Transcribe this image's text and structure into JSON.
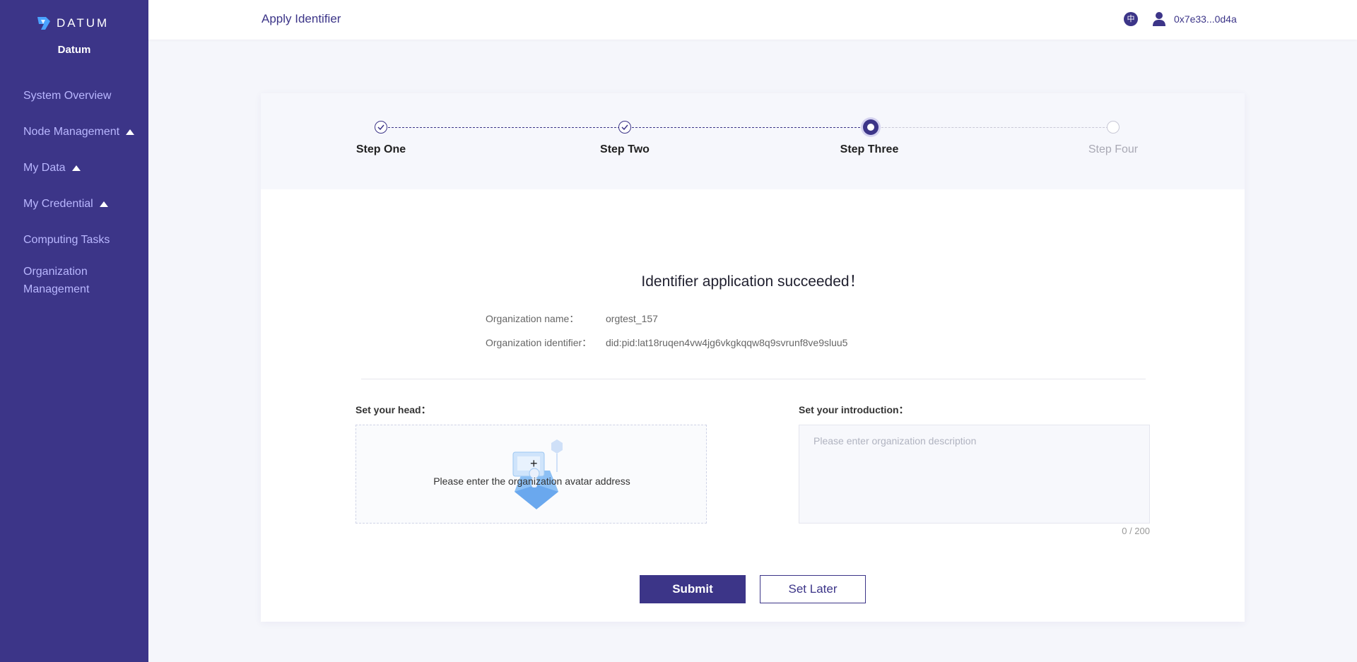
{
  "sidebar": {
    "brand": "DATUM",
    "org_name": "Datum",
    "items": [
      {
        "label": "System Overview"
      },
      {
        "label": "Node Management"
      },
      {
        "label": "My Data"
      },
      {
        "label": "My Credential"
      },
      {
        "label": "Computing Tasks"
      },
      {
        "label": "Organization Management"
      }
    ]
  },
  "header": {
    "title": "Apply Identifier",
    "lang_glyph": "中",
    "address": "0x7e33...0d4a"
  },
  "steps": [
    {
      "label": "Step One",
      "state": "done"
    },
    {
      "label": "Step Two",
      "state": "done"
    },
    {
      "label": "Step Three",
      "state": "active"
    },
    {
      "label": "Step Four",
      "state": "todo"
    }
  ],
  "result": {
    "title": "Identifier application succeeded！",
    "org_name_label": "Organization name：",
    "org_name_value": "orgtest_157",
    "org_id_label": "Organization identifier：",
    "org_id_value": "did:pid:lat18ruqen4vw4jg6vkgkqqw8q9svrunf8ve9sluu5"
  },
  "form": {
    "head_label": "Set your head：",
    "head_hint": "Please enter the organization avatar address",
    "intro_label": "Set your introduction：",
    "intro_placeholder": "Please enter organization description",
    "intro_value": "",
    "counter": "0 / 200"
  },
  "buttons": {
    "submit": "Submit",
    "later": "Set Later"
  },
  "colors": {
    "brand": "#3c3588",
    "nav_text": "#b9b7ff",
    "background": "#f5f6fb"
  }
}
